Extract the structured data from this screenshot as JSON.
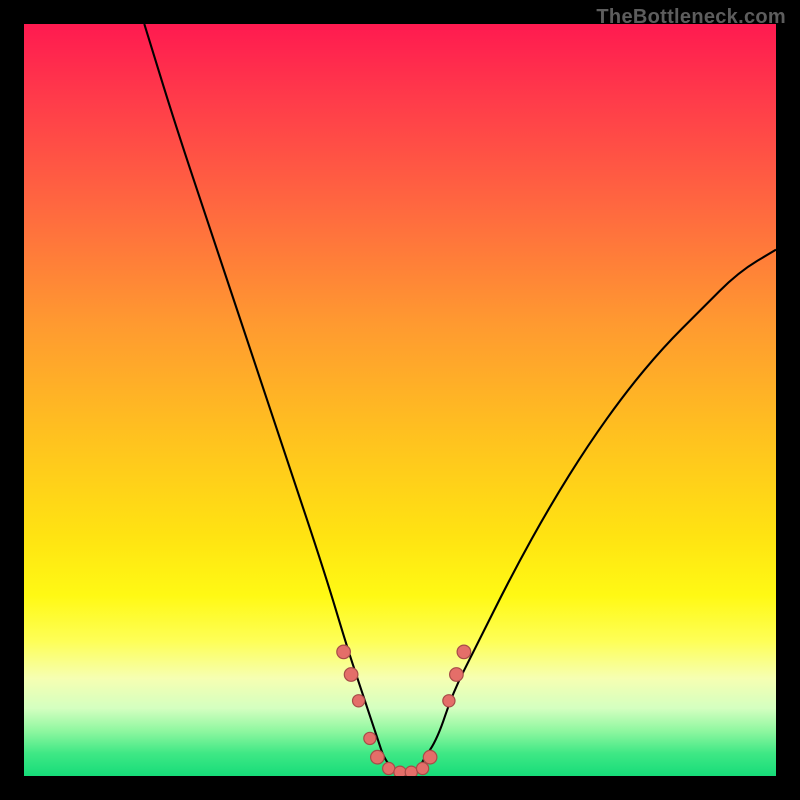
{
  "watermark": "TheBottleneck.com",
  "colors": {
    "background": "#000000",
    "gradient_top": "#ff1a50",
    "gradient_bottom": "#16dc79",
    "curve": "#000000",
    "dot_fill": "#e46e69",
    "dot_stroke": "#a74c48"
  },
  "chart_data": {
    "type": "line",
    "title": "",
    "xlabel": "",
    "ylabel": "",
    "xlim": [
      0,
      100
    ],
    "ylim": [
      0,
      100
    ],
    "grid": false,
    "notes": "Y represents mismatch/bottleneck percentage (100 at top, 0 at bottom). Curve is a V-shape bottoming out near x≈50 at y≈0, rising steeply on both sides. Left branch reaches y=100 around x≈16; right branch reaches y≈70 at x=100.",
    "series": [
      {
        "name": "bottleneck-curve",
        "x": [
          16,
          20,
          25,
          30,
          35,
          40,
          43,
          45,
          47,
          48,
          50,
          52,
          53,
          55,
          57,
          60,
          65,
          70,
          75,
          80,
          85,
          90,
          95,
          100
        ],
        "y": [
          100,
          87,
          72,
          57,
          42,
          27,
          17,
          11,
          5,
          2,
          0,
          0,
          2,
          5,
          11,
          17,
          27,
          36,
          44,
          51,
          57,
          62,
          67,
          70
        ]
      }
    ],
    "markers": {
      "name": "trough-dots",
      "points": [
        {
          "x": 42.5,
          "y": 16.5,
          "r": 1.0
        },
        {
          "x": 43.5,
          "y": 13.5,
          "r": 1.0
        },
        {
          "x": 44.5,
          "y": 10.0,
          "r": 0.9
        },
        {
          "x": 46.0,
          "y": 5.0,
          "r": 0.9
        },
        {
          "x": 47.0,
          "y": 2.5,
          "r": 1.0
        },
        {
          "x": 48.5,
          "y": 1.0,
          "r": 0.9
        },
        {
          "x": 50.0,
          "y": 0.5,
          "r": 0.9
        },
        {
          "x": 51.5,
          "y": 0.5,
          "r": 0.9
        },
        {
          "x": 53.0,
          "y": 1.0,
          "r": 0.9
        },
        {
          "x": 54.0,
          "y": 2.5,
          "r": 1.0
        },
        {
          "x": 56.5,
          "y": 10.0,
          "r": 0.9
        },
        {
          "x": 57.5,
          "y": 13.5,
          "r": 1.0
        },
        {
          "x": 58.5,
          "y": 16.5,
          "r": 1.0
        }
      ]
    }
  }
}
